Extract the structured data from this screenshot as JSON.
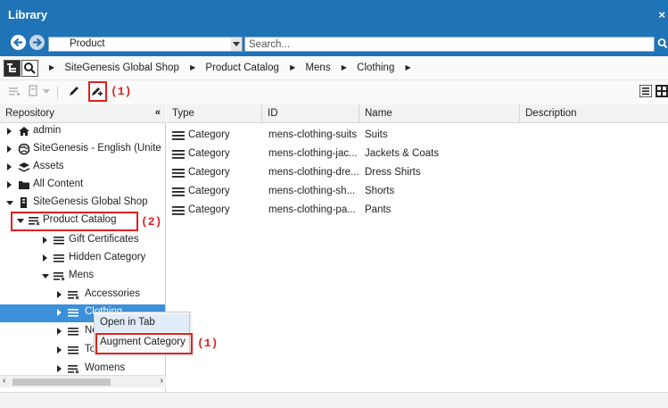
{
  "window": {
    "title": "Library",
    "close_glyph": "×"
  },
  "navbar": {
    "context_value": "Product",
    "search_placeholder": "Search..."
  },
  "breadcrumb": [
    "SiteGenesis Global Shop",
    "Product Catalog",
    "Mens",
    "Clothing"
  ],
  "breadcrumb_separator": "▶",
  "toolbar": {
    "callout_label": "(1)"
  },
  "repository": {
    "header": "Repository",
    "collapse_glyph": "«",
    "items": [
      {
        "label": "admin",
        "icon": "home-icon"
      },
      {
        "label": "SiteGenesis - English (Unite",
        "icon": "globe-icon"
      },
      {
        "label": "Assets",
        "icon": "stack-icon"
      },
      {
        "label": "All Content",
        "icon": "folder-icon"
      },
      {
        "label": "SiteGenesis Global Shop",
        "icon": "site-icon"
      },
      {
        "label": "Product Catalog",
        "icon": "catalog-icon"
      },
      {
        "label": "Gift Certificates",
        "icon": "category-icon"
      },
      {
        "label": "Hidden Category",
        "icon": "category-icon"
      },
      {
        "label": "Mens",
        "icon": "catalog-icon"
      },
      {
        "label": "Accessories",
        "icon": "catalog-icon"
      },
      {
        "label": "Clothing",
        "icon": "category-icon"
      },
      {
        "label": "New",
        "icon": "category-icon"
      },
      {
        "label": "Top S",
        "icon": "category-icon"
      },
      {
        "label": "Womens",
        "icon": "catalog-icon"
      }
    ],
    "callout_label": "(2)"
  },
  "grid": {
    "columns": [
      "Type",
      "ID",
      "Name",
      "Description"
    ],
    "rows": [
      {
        "type": "Category",
        "id": "mens-clothing-suits",
        "name": "Suits",
        "description": ""
      },
      {
        "type": "Category",
        "id": "mens-clothing-jac...",
        "name": "Jackets & Coats",
        "description": ""
      },
      {
        "type": "Category",
        "id": "mens-clothing-dre...",
        "name": "Dress Shirts",
        "description": ""
      },
      {
        "type": "Category",
        "id": "mens-clothing-sh...",
        "name": "Shorts",
        "description": ""
      },
      {
        "type": "Category",
        "id": "mens-clothing-pa...",
        "name": "Pants",
        "description": ""
      }
    ]
  },
  "context_menu": {
    "items": [
      "Open in Tab",
      "Augment Category"
    ],
    "callout_label": "(1)"
  },
  "colors": {
    "brand_blue": "#1f73b7",
    "selection_blue": "#3c8fd9",
    "annotation_red": "#e02020"
  }
}
